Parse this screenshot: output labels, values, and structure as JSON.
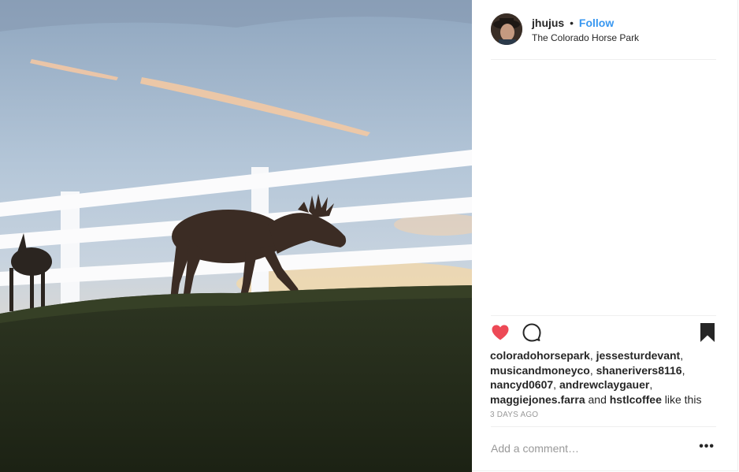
{
  "post": {
    "photo_alt": "",
    "header": {
      "username": "jhujus",
      "separator": "•",
      "follow_label": "Follow",
      "location": "The Colorado Horse Park"
    },
    "actions": {
      "like_icon": "heart-filled-icon",
      "comment_icon": "comment-icon",
      "save_icon": "bookmark-filled-icon",
      "like_color": "#ed4956"
    },
    "likes": {
      "users": [
        "coloradohorsepark",
        "jessesturdevant",
        "musicandmoneyco",
        "shanerivers8116",
        "nancyd0607",
        "andrewclaygauer",
        "maggiejones.farra",
        "hstlcoffee"
      ],
      "comma": ", ",
      "and_text": " and ",
      "suffix": " like this"
    },
    "timestamp": "3 days ago",
    "comment": {
      "placeholder": "Add a comment…",
      "value": "",
      "more_label": "•••"
    }
  },
  "colors": {
    "link_blue": "#3897f0",
    "text": "#262626",
    "muted": "#999999",
    "border": "#efefef"
  }
}
